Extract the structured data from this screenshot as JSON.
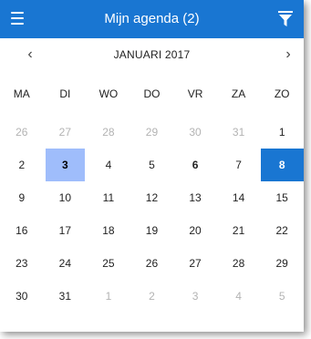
{
  "appbar": {
    "title": "Mijn agenda (2)",
    "menu_icon": "hamburger-menu-icon",
    "filter_icon": "filter-icon"
  },
  "month": {
    "label": "JANUARI 2017",
    "prev": "‹",
    "next": "›"
  },
  "weekdays": [
    "MA",
    "DI",
    "WO",
    "DO",
    "VR",
    "ZA",
    "ZO"
  ],
  "days": [
    {
      "d": "26",
      "muted": true
    },
    {
      "d": "27",
      "muted": true
    },
    {
      "d": "28",
      "muted": true
    },
    {
      "d": "29",
      "muted": true
    },
    {
      "d": "30",
      "muted": true
    },
    {
      "d": "31",
      "muted": true
    },
    {
      "d": "1"
    },
    {
      "d": "2"
    },
    {
      "d": "3",
      "today": true
    },
    {
      "d": "4"
    },
    {
      "d": "5"
    },
    {
      "d": "6",
      "bold": true
    },
    {
      "d": "7"
    },
    {
      "d": "8",
      "selected": true
    },
    {
      "d": "9"
    },
    {
      "d": "10"
    },
    {
      "d": "11"
    },
    {
      "d": "12"
    },
    {
      "d": "13"
    },
    {
      "d": "14"
    },
    {
      "d": "15"
    },
    {
      "d": "16"
    },
    {
      "d": "17"
    },
    {
      "d": "18"
    },
    {
      "d": "19"
    },
    {
      "d": "20"
    },
    {
      "d": "21"
    },
    {
      "d": "22"
    },
    {
      "d": "23"
    },
    {
      "d": "24"
    },
    {
      "d": "25"
    },
    {
      "d": "26"
    },
    {
      "d": "27"
    },
    {
      "d": "28"
    },
    {
      "d": "29"
    },
    {
      "d": "30"
    },
    {
      "d": "31"
    },
    {
      "d": "1",
      "muted": true
    },
    {
      "d": "2",
      "muted": true
    },
    {
      "d": "3",
      "muted": true
    },
    {
      "d": "4",
      "muted": true
    },
    {
      "d": "5",
      "muted": true
    }
  ],
  "colors": {
    "accent": "#1976d2",
    "today_bg": "#9fbdfb",
    "muted_text": "#b3b3b3"
  }
}
